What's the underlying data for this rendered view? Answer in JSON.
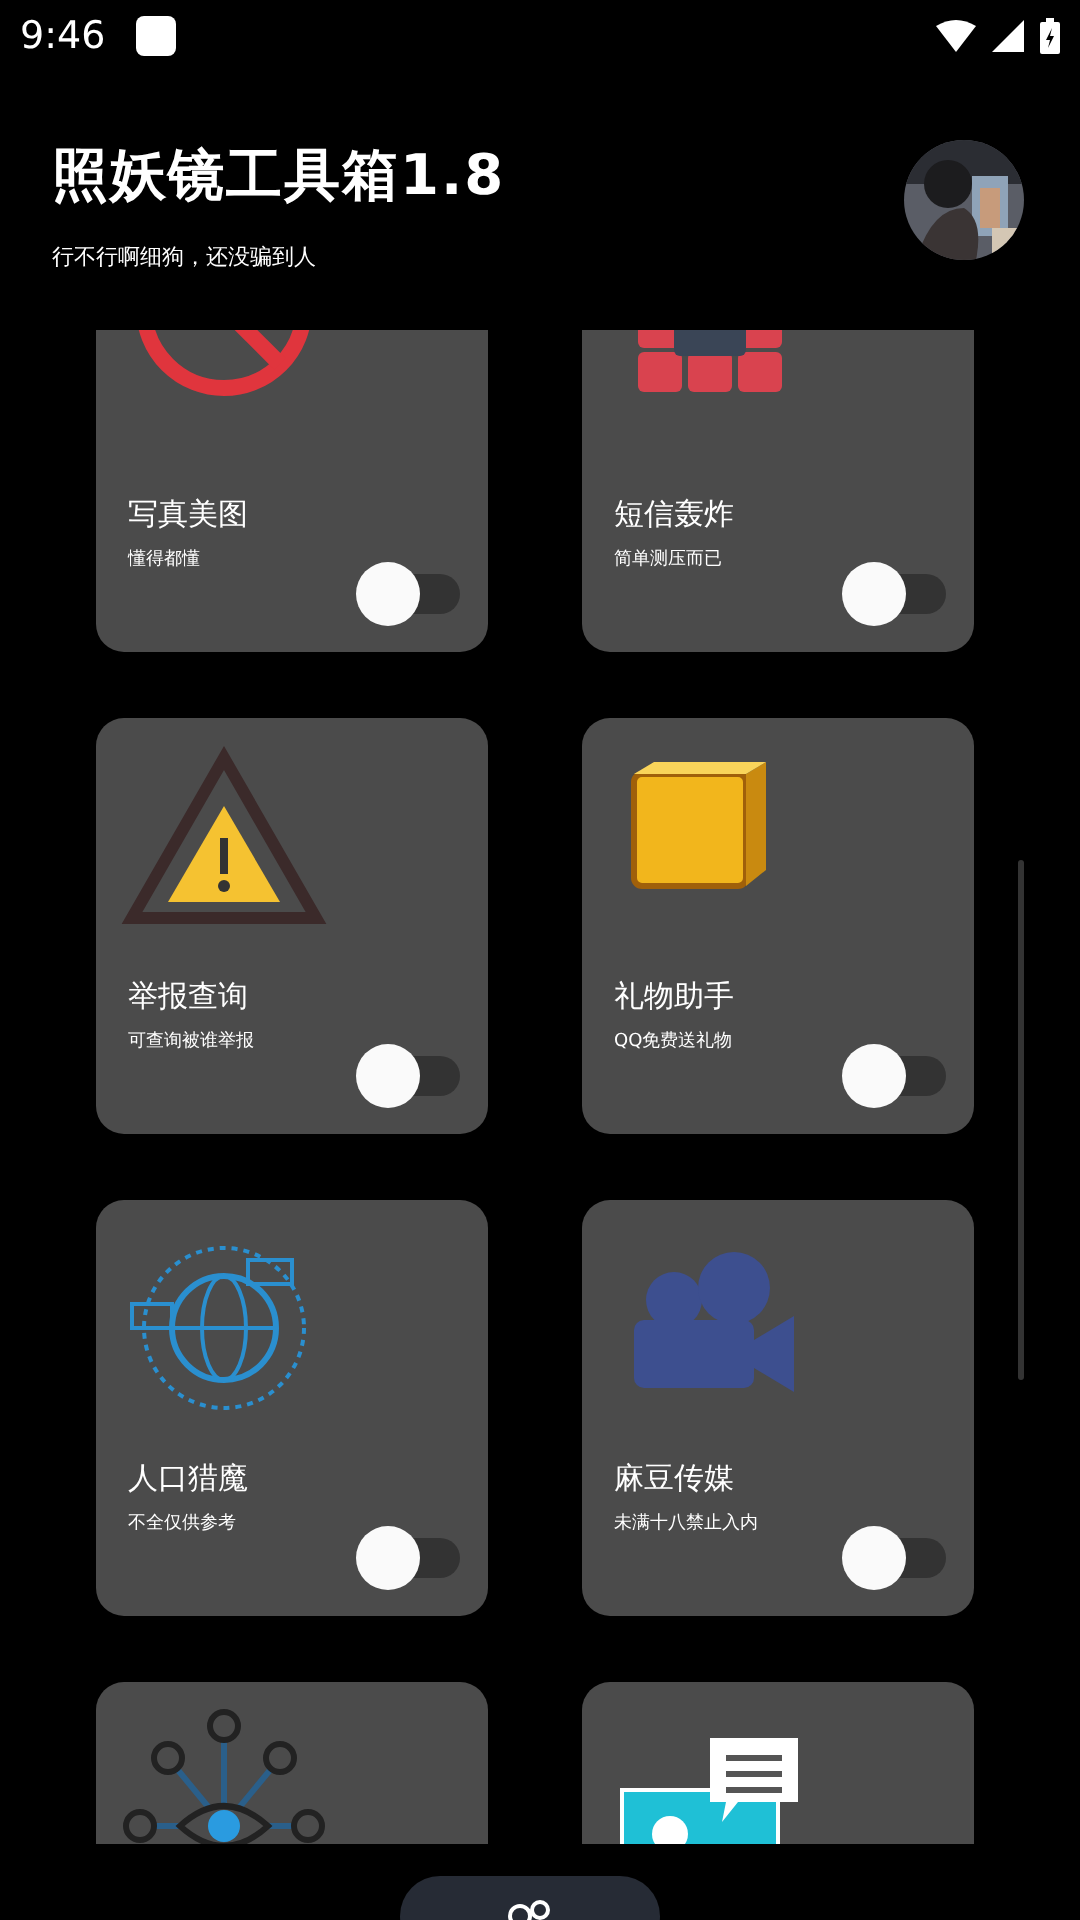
{
  "status_bar": {
    "time": "9:46"
  },
  "header": {
    "title": "照妖镜工具箱1.8",
    "subtitle": "行不行啊细狗，还没骗到人"
  },
  "tools": [
    {
      "kind": "toggle",
      "title": "写真美图",
      "subtitle": "懂得都懂",
      "on": false
    },
    {
      "kind": "toggle",
      "title": "短信轰炸",
      "subtitle": "简单测压而已",
      "on": false
    },
    {
      "kind": "toggle",
      "title": "举报查询",
      "subtitle": "可查询被谁举报",
      "on": false
    },
    {
      "kind": "toggle",
      "title": "礼物助手",
      "subtitle": "QQ免费送礼物",
      "on": false
    },
    {
      "kind": "toggle",
      "title": "人口猎魔",
      "subtitle": "不全仅供参考",
      "on": false
    },
    {
      "kind": "toggle",
      "title": "麻豆传媒",
      "subtitle": "未满十八禁止入内",
      "on": false
    },
    {
      "kind": "icon_only"
    },
    {
      "kind": "icon_only"
    }
  ]
}
